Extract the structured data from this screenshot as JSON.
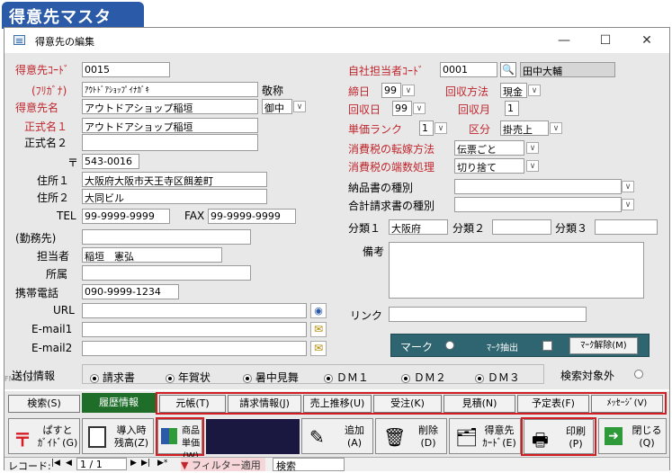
{
  "badge_title": "得意先マスタ",
  "window": {
    "title": "得意先の編集",
    "min": "—",
    "max": "☐",
    "close": "✕"
  },
  "labels": {
    "cust_code": "得意先ｺｰﾄﾞ",
    "kana": "(ﾌﾘｶﾞﾅ)",
    "cust_name": "得意先名",
    "honorific": "敬称",
    "official1": "正式名１",
    "official2": "正式名２",
    "zip": "〒",
    "addr1": "住所１",
    "addr2": "住所２",
    "tel": "TEL",
    "fax": "FAX",
    "workplace": "(勤務先)",
    "person": "担当者",
    "dept": "所属",
    "mobile": "携帯電話",
    "url": "URL",
    "email1": "E-mail1",
    "email2": "E-mail2",
    "staff": "自社担当者ｺｰﾄﾞ",
    "closing": "締日",
    "collect_method": "回収方法",
    "collect_day": "回収日",
    "collect_month": "回収月",
    "price_rank": "単価ランク",
    "category": "区分",
    "tax_shift": "消費税の転嫁方法",
    "tax_round": "消費税の端数処理",
    "delivery_type": "納品書の種別",
    "invoice_type": "合計請求書の種別",
    "class1": "分類１",
    "class2": "分類２",
    "class3": "分類３",
    "remarks": "備考",
    "link": "リンク",
    "send_info": "送付情報",
    "search_exclude": "検索対象外"
  },
  "fields": {
    "cust_code": "0015",
    "kana": "ｱｳﾄﾄﾞｱｼｮｯﾌﾟｲﾅｶﾞｷ",
    "cust_name": "アウトドアショップ稲垣",
    "honorific": "御中",
    "official1": "アウトドアショップ稲垣",
    "official2": "",
    "zip": "543-0016",
    "addr1": "大阪府大阪市天王寺区餌差町",
    "addr2": "大同ビル",
    "tel": "99-9999-9999",
    "fax": "99-9999-9999",
    "workplace": "",
    "person": "稲垣　憲弘",
    "dept": "",
    "mobile": "090-9999-1234",
    "url": "",
    "email1": "",
    "email2": "",
    "staff_code": "0001",
    "staff_name": "田中大輔",
    "closing": "99",
    "collect_method": "現金",
    "collect_day": "99",
    "collect_month": "1",
    "price_rank": "1",
    "category": "掛売上",
    "tax_shift": "伝票ごと",
    "tax_round": "切り捨て",
    "delivery_type": "",
    "invoice_type": "",
    "class1": "大阪府",
    "class2": "",
    "class3": "",
    "remarks": "",
    "link": ""
  },
  "mark_bar": {
    "mark": "マーク",
    "extract": "ﾏｰｸ抽出",
    "clear": "ﾏｰｸ解除(M)"
  },
  "send_options": [
    "請求書",
    "年賀状",
    "暑中見舞",
    "ＤＭ１",
    "ＤＭ２",
    "ＤＭ３"
  ],
  "form_id": "FM-0100",
  "tabs": [
    "検索(S)",
    "履歴情報",
    "元帳(T)",
    "請求情報(J)",
    "売上推移(U)",
    "受注(K)",
    "見積(N)",
    "予定表(F)",
    "ﾒｯｾｰｼﾞ(V)"
  ],
  "buttons": {
    "postal1": "ぱすと",
    "postal2": "ｶﾞｲﾄﾞ(G)",
    "intro1": "導入時",
    "intro2": "残高(Z)",
    "product1": "商品",
    "product2": "単価(W)",
    "add1": "追加",
    "add2": "(A)",
    "del1": "削除",
    "del2": "(D)",
    "card1": "得意先",
    "card2": "ｶｰﾄﾞ(E)",
    "print1": "印刷",
    "print2": "(P)",
    "close1": "閉じる",
    "close2": "(Q)"
  },
  "status": {
    "record_label": "レコード:",
    "first": "|◀",
    "prev": "◀",
    "position": "1 / 1",
    "next": "▶",
    "last": "▶|",
    "new": "▶*",
    "filter": "フィルター適用",
    "search": "検索"
  }
}
